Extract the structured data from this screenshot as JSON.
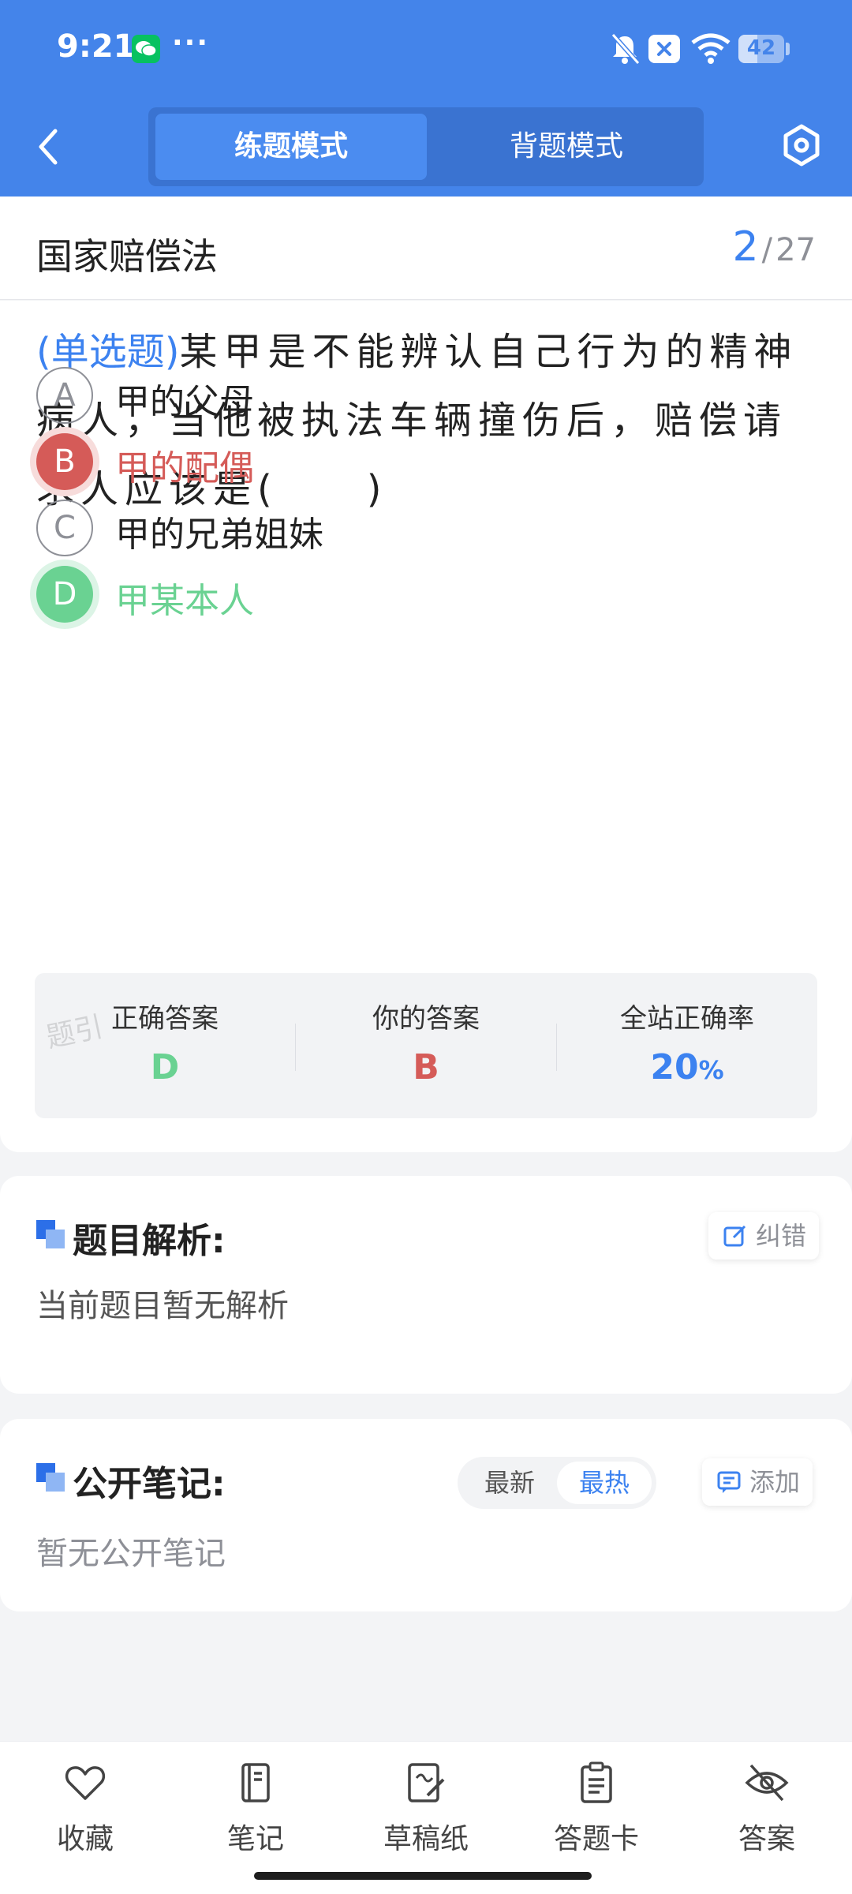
{
  "status_bar": {
    "time": "9:21",
    "more": "···",
    "battery": "42",
    "battery_level": 0.42
  },
  "header": {
    "tabs": [
      {
        "label": "练题模式",
        "active": true
      },
      {
        "label": "背题模式",
        "active": false
      }
    ],
    "accent_color": "#4484ea"
  },
  "subject": {
    "title": "国家赔偿法",
    "current": "2",
    "separator": "/",
    "total": "27"
  },
  "question": {
    "type": "(单选题)",
    "text": "某甲是不能辨认自己行为的精神病人，当他被执法车辆撞伤后，赔偿请求人应该是(　　)",
    "options": [
      {
        "letter": "A",
        "text": "甲的父母",
        "state": "normal"
      },
      {
        "letter": "B",
        "text": "甲的配偶",
        "state": "wrong"
      },
      {
        "letter": "C",
        "text": "甲的兄弟姐妹",
        "state": "normal"
      },
      {
        "letter": "D",
        "text": "甲某本人",
        "state": "right"
      }
    ]
  },
  "stats": {
    "watermark": "题引",
    "items": [
      {
        "label": "正确答案",
        "value": "D",
        "color": "#6ad292"
      },
      {
        "label": "你的答案",
        "value": "B",
        "color": "#d55b58"
      },
      {
        "label": "全站正确率",
        "value": "20",
        "unit": "%",
        "color": "#3c82f0"
      }
    ]
  },
  "analysis": {
    "title": "题目解析:",
    "report_label": "纠错",
    "body": "当前题目暂无解析"
  },
  "notes": {
    "title": "公开笔记:",
    "sort": [
      "最新",
      "最热"
    ],
    "sort_active": "最热",
    "add_label": "添加",
    "body": "暂无公开笔记"
  },
  "bottom_nav": [
    {
      "label": "收藏",
      "icon": "heart-icon"
    },
    {
      "label": "笔记",
      "icon": "notebook-icon"
    },
    {
      "label": "草稿纸",
      "icon": "scratchpad-icon"
    },
    {
      "label": "答题卡",
      "icon": "answer-card-icon"
    },
    {
      "label": "答案",
      "icon": "eye-off-icon"
    }
  ]
}
